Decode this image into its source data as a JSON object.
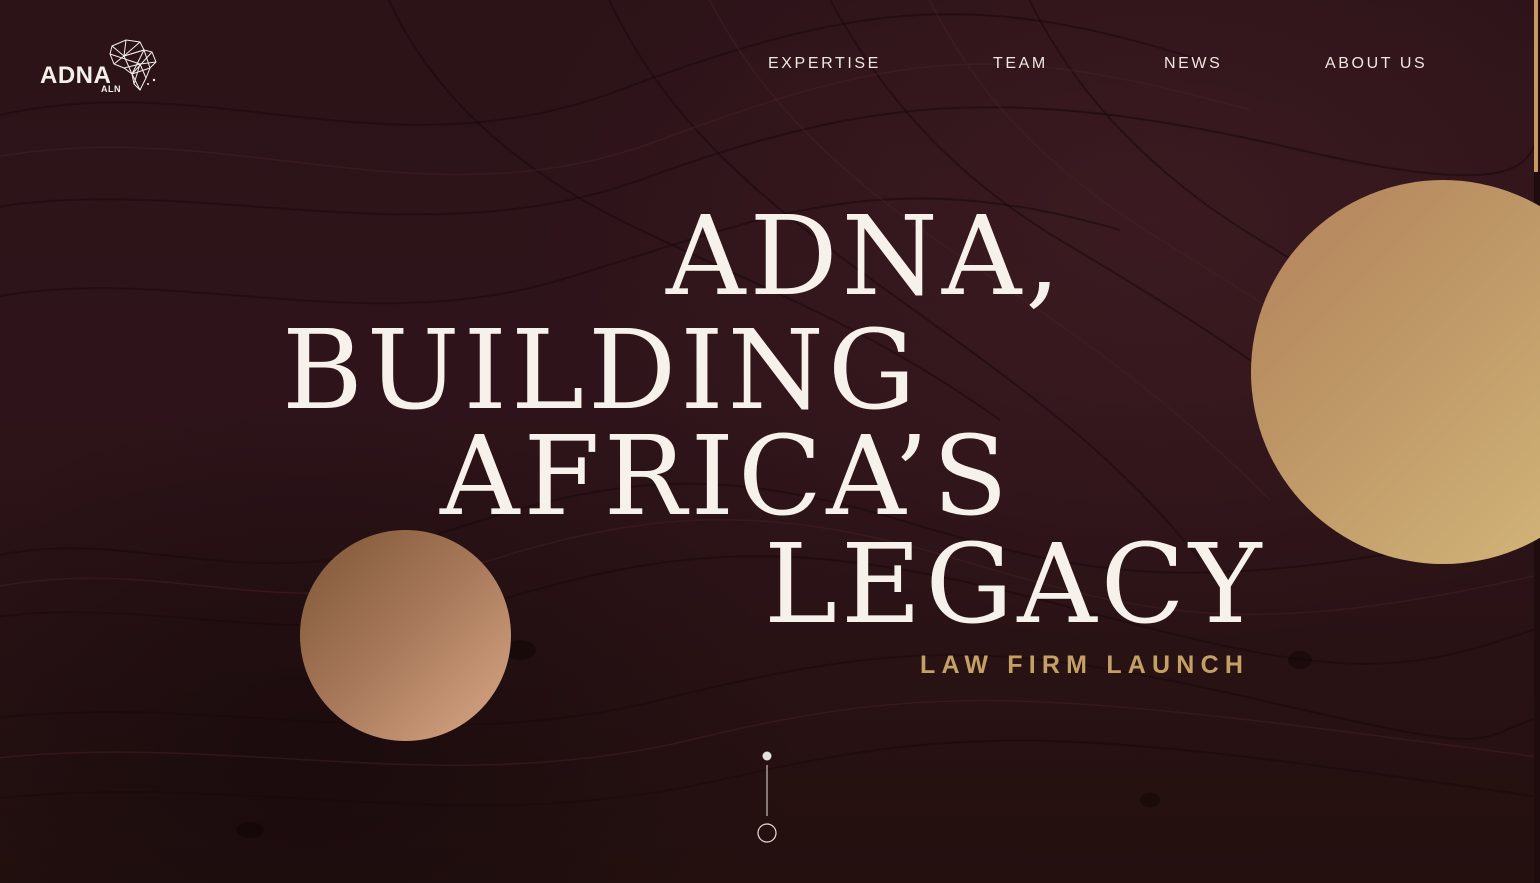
{
  "brand": {
    "name": "ADNA",
    "sub": "ALN",
    "logo_icon": "africa-network-map-icon"
  },
  "nav": {
    "items": [
      {
        "label": "EXPERTISE"
      },
      {
        "label": "TEAM"
      },
      {
        "label": "NEWS"
      },
      {
        "label": "ABOUT US"
      }
    ]
  },
  "hero": {
    "headline": [
      "ADNA,",
      "BUILDING",
      "AFRICA’S",
      "LEGACY"
    ],
    "subtitle": "LAW FIRM LAUNCH"
  },
  "scroll_indicator": {
    "icon": "scroll-down-indicator-icon"
  },
  "colors": {
    "background": "#2a1217",
    "headline_text": "#f6f1ea",
    "accent_gold": "#c5a064",
    "circle_large": "#c09a68",
    "circle_small": "#a8795a"
  }
}
